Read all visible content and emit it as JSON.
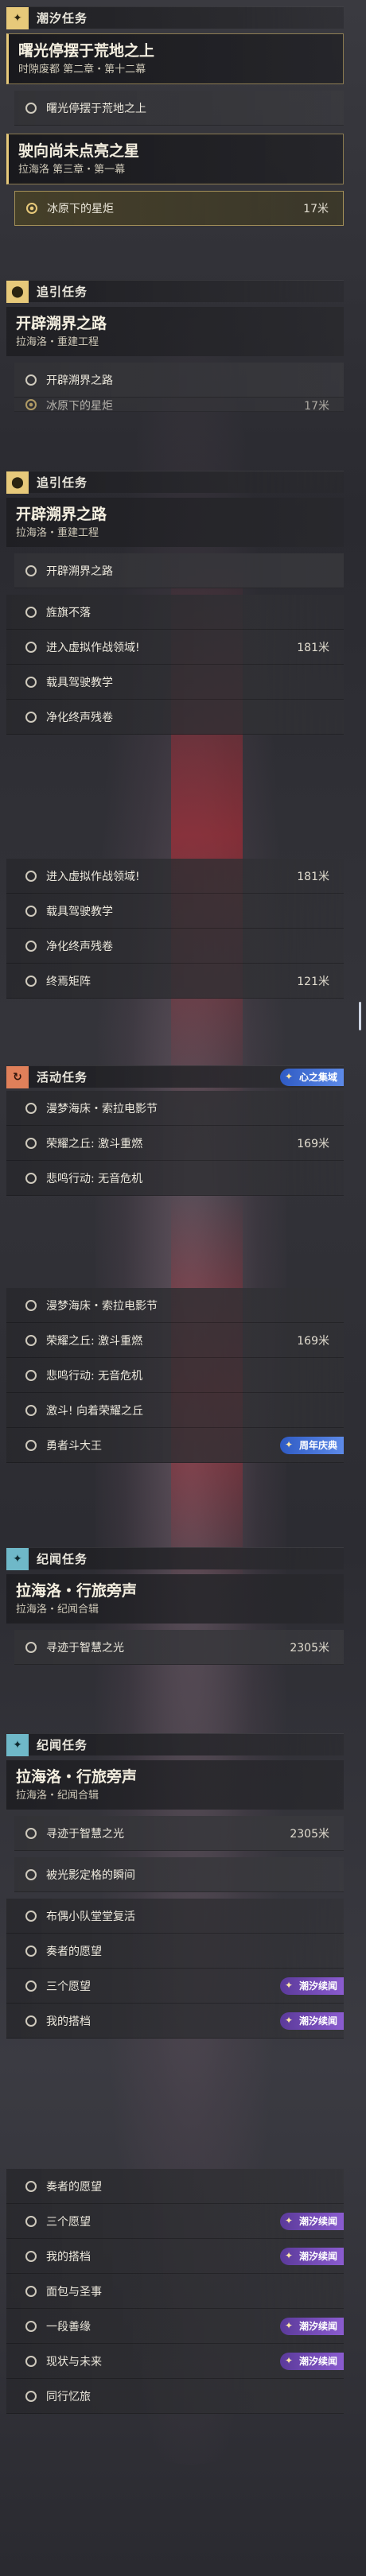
{
  "sections": {
    "s1_cat": "潮汐任务",
    "s1_main_title": "曙光停摆于荒地之上",
    "s1_main_sub": "时隙废都 第二章・第十二幕",
    "s1_sub1": "曙光停摆于荒地之上",
    "s1_main2_title": "驶向尚未点亮之星",
    "s1_main2_sub": "拉海洛 第三章・第一幕",
    "s1_active_label": "冰原下的星炬",
    "s1_active_dist": "17米",
    "s2_cat": "追引任务",
    "s2_main_title": "开辟溯界之路",
    "s2_main_sub": "拉海洛・重建工程",
    "s2_sub1": "开辟溯界之路",
    "s2_peek_label": "冰原下的星炬",
    "s2_peek_dist": "17米",
    "s3_cat": "追引任务",
    "s3_main_title": "开辟溯界之路",
    "s3_main_sub": "拉海洛・重建工程",
    "s3_rows": [
      {
        "label": "开辟溯界之路",
        "dist": "",
        "sub": true
      },
      {
        "label": "旌旗不落",
        "dist": ""
      },
      {
        "label": "进入虚拟作战领域!",
        "dist": "181米"
      },
      {
        "label": "载具驾驶教学",
        "dist": ""
      },
      {
        "label": "净化终声残卷",
        "dist": ""
      }
    ],
    "s4_rows": [
      {
        "label": "进入虚拟作战领域!",
        "dist": "181米"
      },
      {
        "label": "载具驾驶教学",
        "dist": ""
      },
      {
        "label": "净化终声残卷",
        "dist": ""
      },
      {
        "label": "终焉矩阵",
        "dist": "121米"
      }
    ],
    "s5_cat": "活动任务",
    "s5_tag": "心之集域",
    "s5_rows": [
      {
        "label": "漫梦海床・索拉电影节",
        "dist": ""
      },
      {
        "label": "荣耀之丘: 激斗重燃",
        "dist": "169米"
      },
      {
        "label": "悲鸣行动: 无音危机",
        "dist": ""
      }
    ],
    "s6_rows": [
      {
        "label": "漫梦海床・索拉电影节",
        "dist": ""
      },
      {
        "label": "荣耀之丘: 激斗重燃",
        "dist": "169米"
      },
      {
        "label": "悲鸣行动: 无音危机",
        "dist": ""
      },
      {
        "label": "激斗! 向着荣耀之丘",
        "dist": ""
      },
      {
        "label": "勇者斗大王",
        "dist": ""
      }
    ],
    "s6_tag": "周年庆典",
    "s7_cat": "纪闻任务",
    "s7_main_title": "拉海洛・行旅旁声",
    "s7_main_sub": "拉海洛・纪闻合辑",
    "s7_sub1": "寻迹于智慧之光",
    "s7_sub1_dist": "2305米",
    "s8_cat": "纪闻任务",
    "s8_main_title": "拉海洛・行旅旁声",
    "s8_main_sub": "拉海洛・纪闻合辑",
    "s8_rows": [
      {
        "label": "寻迹于智慧之光",
        "dist": "2305米",
        "sub": true
      },
      {
        "label": "被光影定格的瞬间",
        "dist": "",
        "sub": true
      },
      {
        "label": "布偶小队堂堂复活",
        "dist": ""
      },
      {
        "label": "奏者的愿望",
        "dist": ""
      },
      {
        "label": "三个愿望",
        "dist": "",
        "tag": "潮汐续闻"
      },
      {
        "label": "我的搭档",
        "dist": "",
        "tag": "潮汐续闻"
      }
    ],
    "s9_rows": [
      {
        "label": "奏者的愿望",
        "dist": ""
      },
      {
        "label": "三个愿望",
        "dist": "",
        "tag": "潮汐续闻"
      },
      {
        "label": "我的搭档",
        "dist": "",
        "tag": "潮汐续闻"
      },
      {
        "label": "面包与圣事",
        "dist": ""
      },
      {
        "label": "一段善缘",
        "dist": "",
        "tag": "潮汐续闻"
      },
      {
        "label": "现状与未来",
        "dist": "",
        "tag": "潮汐续闻"
      },
      {
        "label": "同行忆旅",
        "dist": ""
      }
    ]
  }
}
